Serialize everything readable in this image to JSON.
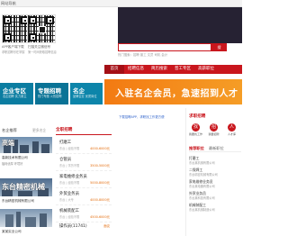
{
  "topbar": {
    "text": "网站导航"
  },
  "qr": {
    "app_caption": "APP客户端下载",
    "app_sub": "求职招聘尽在掌握",
    "wx_caption": "扫描关注微信号",
    "wx_sub": "第一时间获取招聘信息"
  },
  "search": {
    "button": "搜",
    "hotwords": "热门搜索：招聘 普工 文员 司机 会计"
  },
  "nav": {
    "home": "首页",
    "items": [
      "招聘信息",
      "简历搜索",
      "普工专区",
      "高薪职位"
    ]
  },
  "promos": [
    {
      "title": "企业专区",
      "sub": "名企招聘 实力雇主"
    },
    {
      "title": "专题招聘",
      "sub": "热门专题 火热招聘"
    },
    {
      "title": "名企",
      "sub": "品牌企业 优质岗位"
    }
  ],
  "banner": {
    "text": "入驻名企会员，急速招到人才"
  },
  "notice": "下载招聘APP，求职找工作更方便",
  "left": {
    "heading": "名企推荐",
    "more": "更多名企",
    "banner1": "高端",
    "banner2": "东台精密机械",
    "companies": [
      {
        "name": "高新技术有限公司",
        "sub": "福利优厚 环境好"
      },
      {
        "name": "东台精密机械有限公司",
        "sub": ""
      },
      {
        "name": "某某实业公司",
        "sub": ""
      }
    ]
  },
  "middle": {
    "tab": "全职招聘",
    "jobs": [
      {
        "name": "打磨工",
        "meta": "东台 | 经验不限",
        "salary": "4000-6000元"
      },
      {
        "name": "仓管员",
        "meta": "东台 | 学历不限",
        "salary": "3500-5000元"
      },
      {
        "name": "家电维修业务员",
        "meta": "东台 | 经验不限",
        "salary": "5000-8000元"
      },
      {
        "name": "外贸业务员",
        "meta": "东台 | 大专",
        "salary": "4000-8000元"
      },
      {
        "name": "机械装配工",
        "meta": "东台 | 经验不限",
        "salary": "4500-6000元"
      },
      {
        "name": "操作员(11741)",
        "meta": "东台 | 学历不限",
        "salary": "面议"
      }
    ]
  },
  "right": {
    "title": "求职招聘",
    "quick": [
      {
        "icon": "找",
        "label": "我要找工作"
      },
      {
        "icon": "招",
        "label": "我要招聘"
      },
      {
        "icon": "人",
        "label": "人才库"
      }
    ],
    "tabs": [
      "推荐职位",
      "最新职位"
    ],
    "jobs": [
      {
        "name": "打磨工",
        "sub": "东台某机械有限公司"
      },
      {
        "name": "二保焊工",
        "sub": "东台精密机械有限公司"
      },
      {
        "name": "家电维修业务员",
        "sub": "东台某电器有限公司"
      },
      {
        "name": "外贸业务员",
        "sub": "东台某科技有限公司"
      },
      {
        "name": "机械装配工",
        "sub": "东台某机械制造公司"
      }
    ]
  },
  "colors": {
    "brand_red": "#c9161d",
    "teal": "#0b7da1",
    "orange": "#f37a12",
    "dark": "#262233"
  }
}
